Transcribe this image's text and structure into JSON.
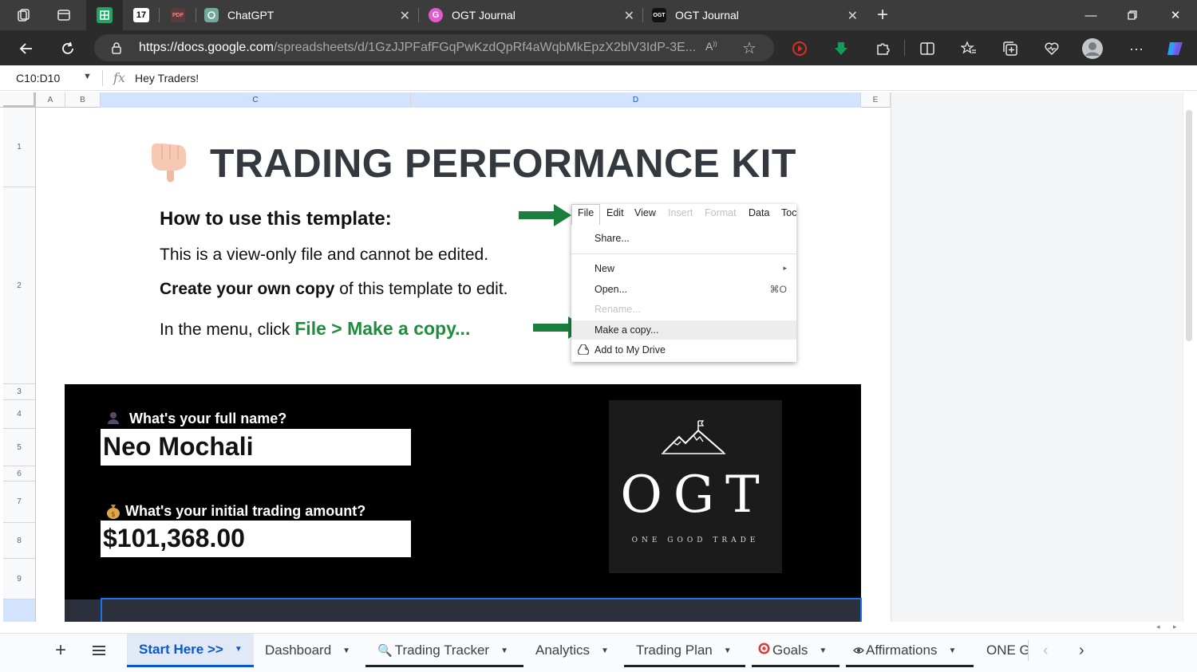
{
  "browser": {
    "tabs": [
      {
        "title": "",
        "icon": "sheets-icon"
      },
      {
        "title": "",
        "icon": "tradingview-icon"
      },
      {
        "title": "",
        "icon": "pdf-icon"
      },
      {
        "title": "ChatGPT",
        "icon": "chatgpt-icon"
      },
      {
        "title": "OGT Journal",
        "icon": "ogt-g-icon"
      },
      {
        "title": "OGT Journal",
        "icon": "ogt-icon"
      }
    ],
    "url_host": "https://docs.google.com",
    "url_path": "/spreadsheets/d/1GzJJPFafFGqPwKzdQpRf4aWqbMkEpzX2blV3IdP-3E..."
  },
  "sheets": {
    "name_box": "C10:D10",
    "formula": "Hey Traders!",
    "columns": [
      "A",
      "B",
      "C",
      "D",
      "E"
    ],
    "rows": [
      "1",
      "2",
      "3",
      "4",
      "5",
      "6",
      "7",
      "8",
      "9",
      ""
    ]
  },
  "content": {
    "title": "TRADING PERFORMANCE KIT",
    "howto_title": "How to use this template:",
    "line1": "This is a view-only file and cannot be edited.",
    "line2_bold": "Create your own copy",
    "line2_rest": " of this template to edit.",
    "line3_prefix": "In the menu, click ",
    "line3_green": "File > Make a copy..."
  },
  "menu_image": {
    "top_items": [
      "File",
      "Edit",
      "View",
      "Insert",
      "Format",
      "Data",
      "Toc"
    ],
    "items": {
      "share": "Share...",
      "new": "New",
      "new_arrow": "▸",
      "open": "Open...",
      "open_shortcut": "⌘O",
      "rename": "Rename...",
      "make_copy": "Make a copy...",
      "add_drive": "Add to My Drive"
    }
  },
  "card": {
    "name_label": "What's your full name?",
    "name_value": "Neo Mochali",
    "amount_label": "What's your initial trading amount?",
    "amount_value": "$101,368.00"
  },
  "logo": {
    "letters": "OGT",
    "tagline": "ONE GOOD TRADE"
  },
  "sheet_tabs": {
    "start_here": "Start Here >>",
    "dashboard": "Dashboard",
    "trading_tracker": "Trading Tracker",
    "analytics": "Analytics",
    "trading_plan": "Trading Plan",
    "goals": "Goals",
    "affirmations": "Affirmations",
    "one_g": "ONE G"
  },
  "colors": {
    "accent_green": "#1e8e3e",
    "selection_blue": "#1a73e8",
    "active_tab_text": "#0b57d0"
  }
}
